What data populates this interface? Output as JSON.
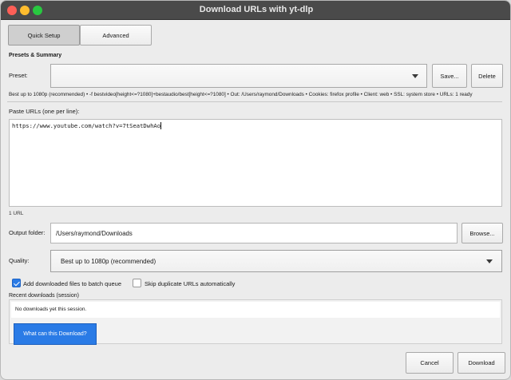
{
  "window": {
    "title": "Download URLs with yt-dlp"
  },
  "tabs": [
    {
      "label": "Quick Setup",
      "active": true
    },
    {
      "label": "Advanced",
      "active": false
    }
  ],
  "presets": {
    "section_label": "Presets & Summary",
    "preset_label": "Preset:",
    "preset_value": "",
    "save_label": "Save...",
    "delete_label": "Delete"
  },
  "summary": "Best up to 1080p (recommended) • -f bestvideo[height<=?1080]+bestaudio/best[height<=?1080] • Out: /Users/raymond/Downloads • Cookies: firefox profile • Client: web • SSL: system store • URLs: 1 ready",
  "urls": {
    "label": "Paste URLs (one per line):",
    "value": "https://www.youtube.com/watch?v=7tSeatDwhAo",
    "count_text": "1 URL"
  },
  "output": {
    "label": "Output folder:",
    "value": "/Users/raymond/Downloads",
    "browse_label": "Browse..."
  },
  "quality": {
    "label": "Quality:",
    "selected": "Best up to 1080p (recommended)"
  },
  "options": {
    "batch_queue": {
      "label": "Add downloaded files to batch queue",
      "checked": true
    },
    "skip_duplicates": {
      "label": "Skip duplicate URLs automatically",
      "checked": false
    }
  },
  "recent": {
    "label": "Recent downloads (session)",
    "empty_text": "No downloads yet this session.",
    "what_can_label": "What can this Download?"
  },
  "footer": {
    "cancel_label": "Cancel",
    "download_label": "Download"
  },
  "colors": {
    "accent": "#2a7be6",
    "titlebar": "#4a4a4a",
    "window_bg": "#ececec"
  },
  "icons": {
    "combo_arrow": "chevron-down-icon",
    "checkmark": "checkmark-icon"
  }
}
